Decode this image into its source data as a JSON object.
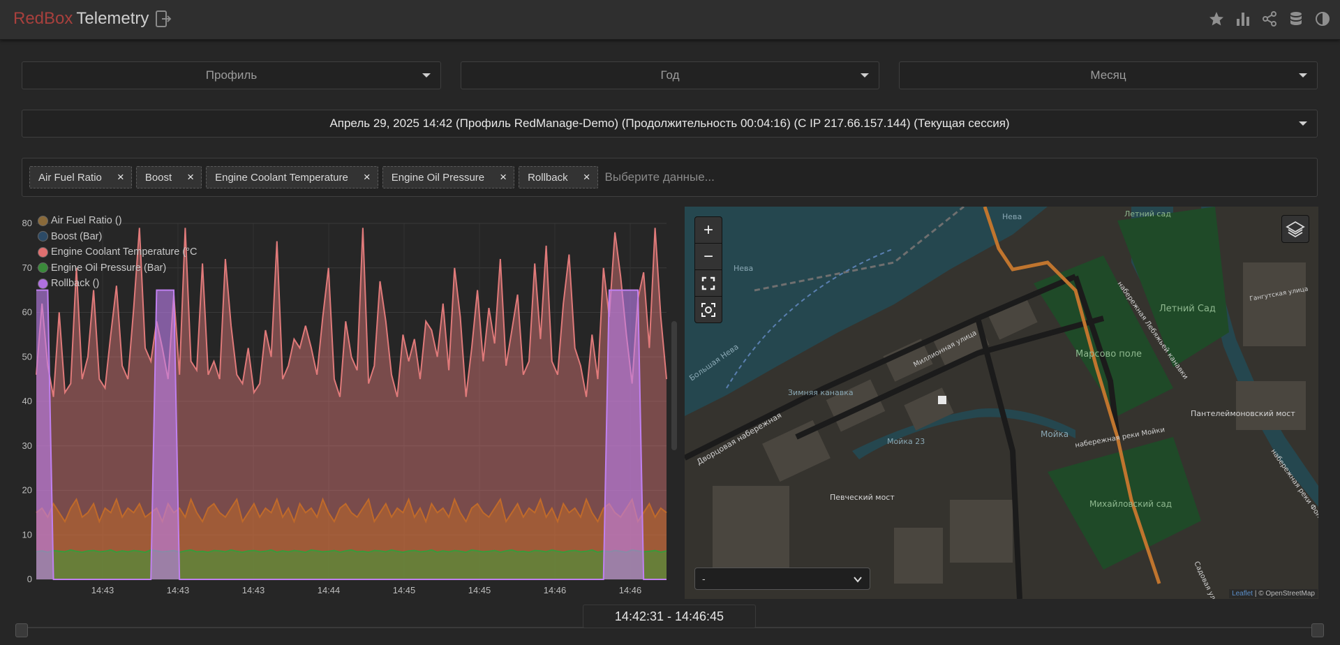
{
  "header": {
    "brand_red": "RedBox",
    "brand_white": "Telemetry",
    "icons": [
      "star-icon",
      "bar-chart-icon",
      "share-icon",
      "database-icon",
      "contrast-icon"
    ]
  },
  "filters": {
    "profile": "Профиль",
    "year": "Год",
    "month": "Месяц"
  },
  "session": {
    "label": "Апрель 29, 2025 14:42 (Профиль RedManage-Demo) (Продолжительность 00:04:16) (С IP 217.66.157.144) (Текущая сессия)"
  },
  "tags": {
    "items": [
      "Air Fuel Ratio",
      "Boost",
      "Engine Coolant Temperature",
      "Engine Oil Pressure",
      "Rollback"
    ],
    "remove_glyph": "×",
    "placeholder": "Выберите данные..."
  },
  "legend": {
    "items": [
      {
        "label": "Air Fuel Ratio ()",
        "color": "#8a6a3a"
      },
      {
        "label": "Boost (Bar)",
        "color": "#2c4a66"
      },
      {
        "label": "Engine Coolant Temperature (°C",
        "color": "#e07070"
      },
      {
        "label": "Engine Oil Pressure (Bar)",
        "color": "#3a8a3a"
      },
      {
        "label": "Rollback ()",
        "color": "#b070e0"
      }
    ]
  },
  "chart_data": {
    "type": "area",
    "x_tick_labels": [
      "14:43",
      "14:43",
      "14:43",
      "14:44",
      "14:45",
      "14:45",
      "14:46",
      "14:46"
    ],
    "ylim": [
      0,
      80
    ],
    "y_ticks": [
      0,
      10,
      20,
      30,
      40,
      50,
      60,
      70,
      80
    ],
    "grid": true,
    "legend_position": "top-left",
    "series": [
      {
        "name": "Engine Coolant Temperature (°C",
        "color": "#e07a7a",
        "values": [
          46,
          62,
          48,
          41,
          60,
          42,
          44,
          70,
          45,
          50,
          65,
          45,
          43,
          55,
          66,
          48,
          45,
          61,
          79,
          52,
          49,
          58,
          52,
          45,
          64,
          46,
          79,
          49,
          47,
          71,
          46,
          49,
          45,
          72,
          57,
          46,
          44,
          52,
          42,
          44,
          56,
          50,
          76,
          45,
          48,
          54,
          52,
          57,
          52,
          46,
          59,
          70,
          45,
          41,
          58,
          50,
          47,
          79,
          44,
          48,
          67,
          58,
          46,
          41,
          55,
          49,
          54,
          45,
          58,
          56,
          50,
          62,
          47,
          70,
          59,
          41,
          52,
          65,
          49,
          61,
          53,
          72,
          48,
          56,
          64,
          46,
          49,
          71,
          54,
          75,
          49,
          46,
          62,
          73,
          52,
          48,
          41,
          55,
          45,
          70,
          59,
          78,
          68,
          55,
          44,
          63,
          69,
          52,
          79,
          59,
          45
        ]
      },
      {
        "name": "Air Fuel Ratio ()",
        "color": "#c06a2a",
        "values": [
          15,
          16,
          14,
          17,
          15,
          13,
          16,
          18,
          14,
          15,
          17,
          13,
          16,
          15,
          18,
          14,
          16,
          15,
          17,
          14,
          15,
          16,
          13,
          17,
          15,
          16,
          14,
          18,
          15,
          13,
          16,
          17,
          15,
          14,
          16,
          18,
          13,
          15,
          17,
          14,
          16,
          15,
          18,
          14,
          16,
          13,
          17,
          15,
          16,
          14,
          18,
          15,
          13,
          16,
          17,
          15,
          14,
          16,
          18,
          13,
          15,
          17,
          14,
          16,
          15,
          18,
          14,
          16,
          13,
          17,
          15,
          16,
          14,
          18,
          15,
          13,
          16,
          17,
          15,
          14,
          16,
          18,
          13,
          15,
          17,
          14,
          16,
          15,
          18,
          14,
          16,
          13,
          17,
          15,
          16,
          14,
          18,
          15,
          13,
          16,
          17,
          15,
          14,
          16,
          18,
          13,
          15,
          17,
          14,
          16,
          15
        ]
      },
      {
        "name": "Engine Oil Pressure (Bar)",
        "color": "#3a9a3a",
        "values": [
          6.2,
          6.4,
          6.1,
          6.5,
          6.3,
          6.2,
          6.6,
          6.3,
          6.1,
          6.4,
          6.5,
          6.2,
          6.3,
          6.6,
          6.1,
          6.4,
          6.2,
          6.5,
          6.3,
          6.1,
          6.6,
          6.4,
          6.2,
          6.3,
          6.5,
          6.1,
          6.4,
          6.6,
          6.2,
          6.3,
          6.1,
          6.5,
          6.4,
          6.2,
          6.6,
          6.3,
          6.1,
          6.4,
          6.5,
          6.2,
          6.3,
          6.6,
          6.1,
          6.4,
          6.2,
          6.5,
          6.3,
          6.1,
          6.6,
          6.4,
          6.2,
          6.3,
          6.5,
          6.1,
          6.4,
          6.6,
          6.2,
          6.3,
          6.1,
          6.5,
          6.4,
          6.2,
          6.6,
          6.3,
          6.1,
          6.4,
          6.5,
          6.2,
          6.3,
          6.6,
          6.1,
          6.4,
          6.2,
          6.5,
          6.3,
          6.1,
          6.6,
          6.4,
          6.2,
          6.3,
          6.5,
          6.1,
          6.4,
          6.6,
          6.2,
          6.3,
          6.1,
          6.5,
          6.4,
          6.2,
          6.6,
          6.3,
          6.1,
          6.4,
          6.5,
          6.2,
          6.3,
          6.6,
          6.1,
          6.4,
          6.2,
          6.5,
          6.3,
          6.1,
          6.6,
          6.4,
          6.2,
          6.3,
          6.5,
          6.1,
          6.4
        ]
      },
      {
        "name": "Rollback ()",
        "color": "#c080f0",
        "values": [
          65,
          65,
          65,
          0,
          0,
          0,
          0,
          0,
          0,
          0,
          0,
          0,
          0,
          0,
          0,
          0,
          0,
          0,
          0,
          0,
          0,
          65,
          65,
          65,
          65,
          0,
          0,
          0,
          0,
          0,
          0,
          0,
          0,
          0,
          0,
          0,
          0,
          0,
          0,
          0,
          0,
          0,
          0,
          0,
          0,
          0,
          0,
          0,
          0,
          0,
          0,
          0,
          0,
          0,
          0,
          0,
          0,
          0,
          0,
          0,
          0,
          0,
          0,
          0,
          0,
          0,
          0,
          0,
          0,
          0,
          0,
          0,
          0,
          0,
          0,
          0,
          0,
          0,
          0,
          0,
          0,
          0,
          0,
          0,
          0,
          0,
          0,
          0,
          0,
          0,
          0,
          0,
          0,
          0,
          0,
          0,
          0,
          0,
          0,
          0,
          65,
          65,
          65,
          65,
          65,
          65,
          0,
          0,
          0,
          0,
          0
        ]
      }
    ]
  },
  "map": {
    "zoom_in": "+",
    "zoom_out": "−",
    "select_value": "-",
    "attribution_leaflet": "Leaflet",
    "attribution_rest": "| © OpenStreetMap",
    "labels": {
      "neva1": "Нева",
      "neva2": "Нева",
      "bolshaya_neva": "Большая Нева",
      "letniy_sad_top": "Летний сад",
      "letniy_sad": "Летний Сад",
      "marsovo_pole": "Марсово поле",
      "zimnyaya": "Зимняя канавка",
      "millionnaya": "Миллионная улица",
      "dvortsovaya": "Дворцовая набережная",
      "pevchesky": "Певческий мост",
      "panteleimonovsky": "Пантелеймоновский мост",
      "mikhaylovsky": "Михайловский сад",
      "moyka": "Мойка",
      "moyka23": "Мойка 23",
      "nab_moyki": "набережная реки Мойки",
      "nab_lebyazhey": "набережная Лебяжьей канавки",
      "fontanka": "набережная реки Фонтанки",
      "sadovaya": "Садовая улица",
      "gangutskaya": "Гангутская улица"
    }
  },
  "time_range": {
    "label": "14:42:31 - 14:46:45"
  }
}
